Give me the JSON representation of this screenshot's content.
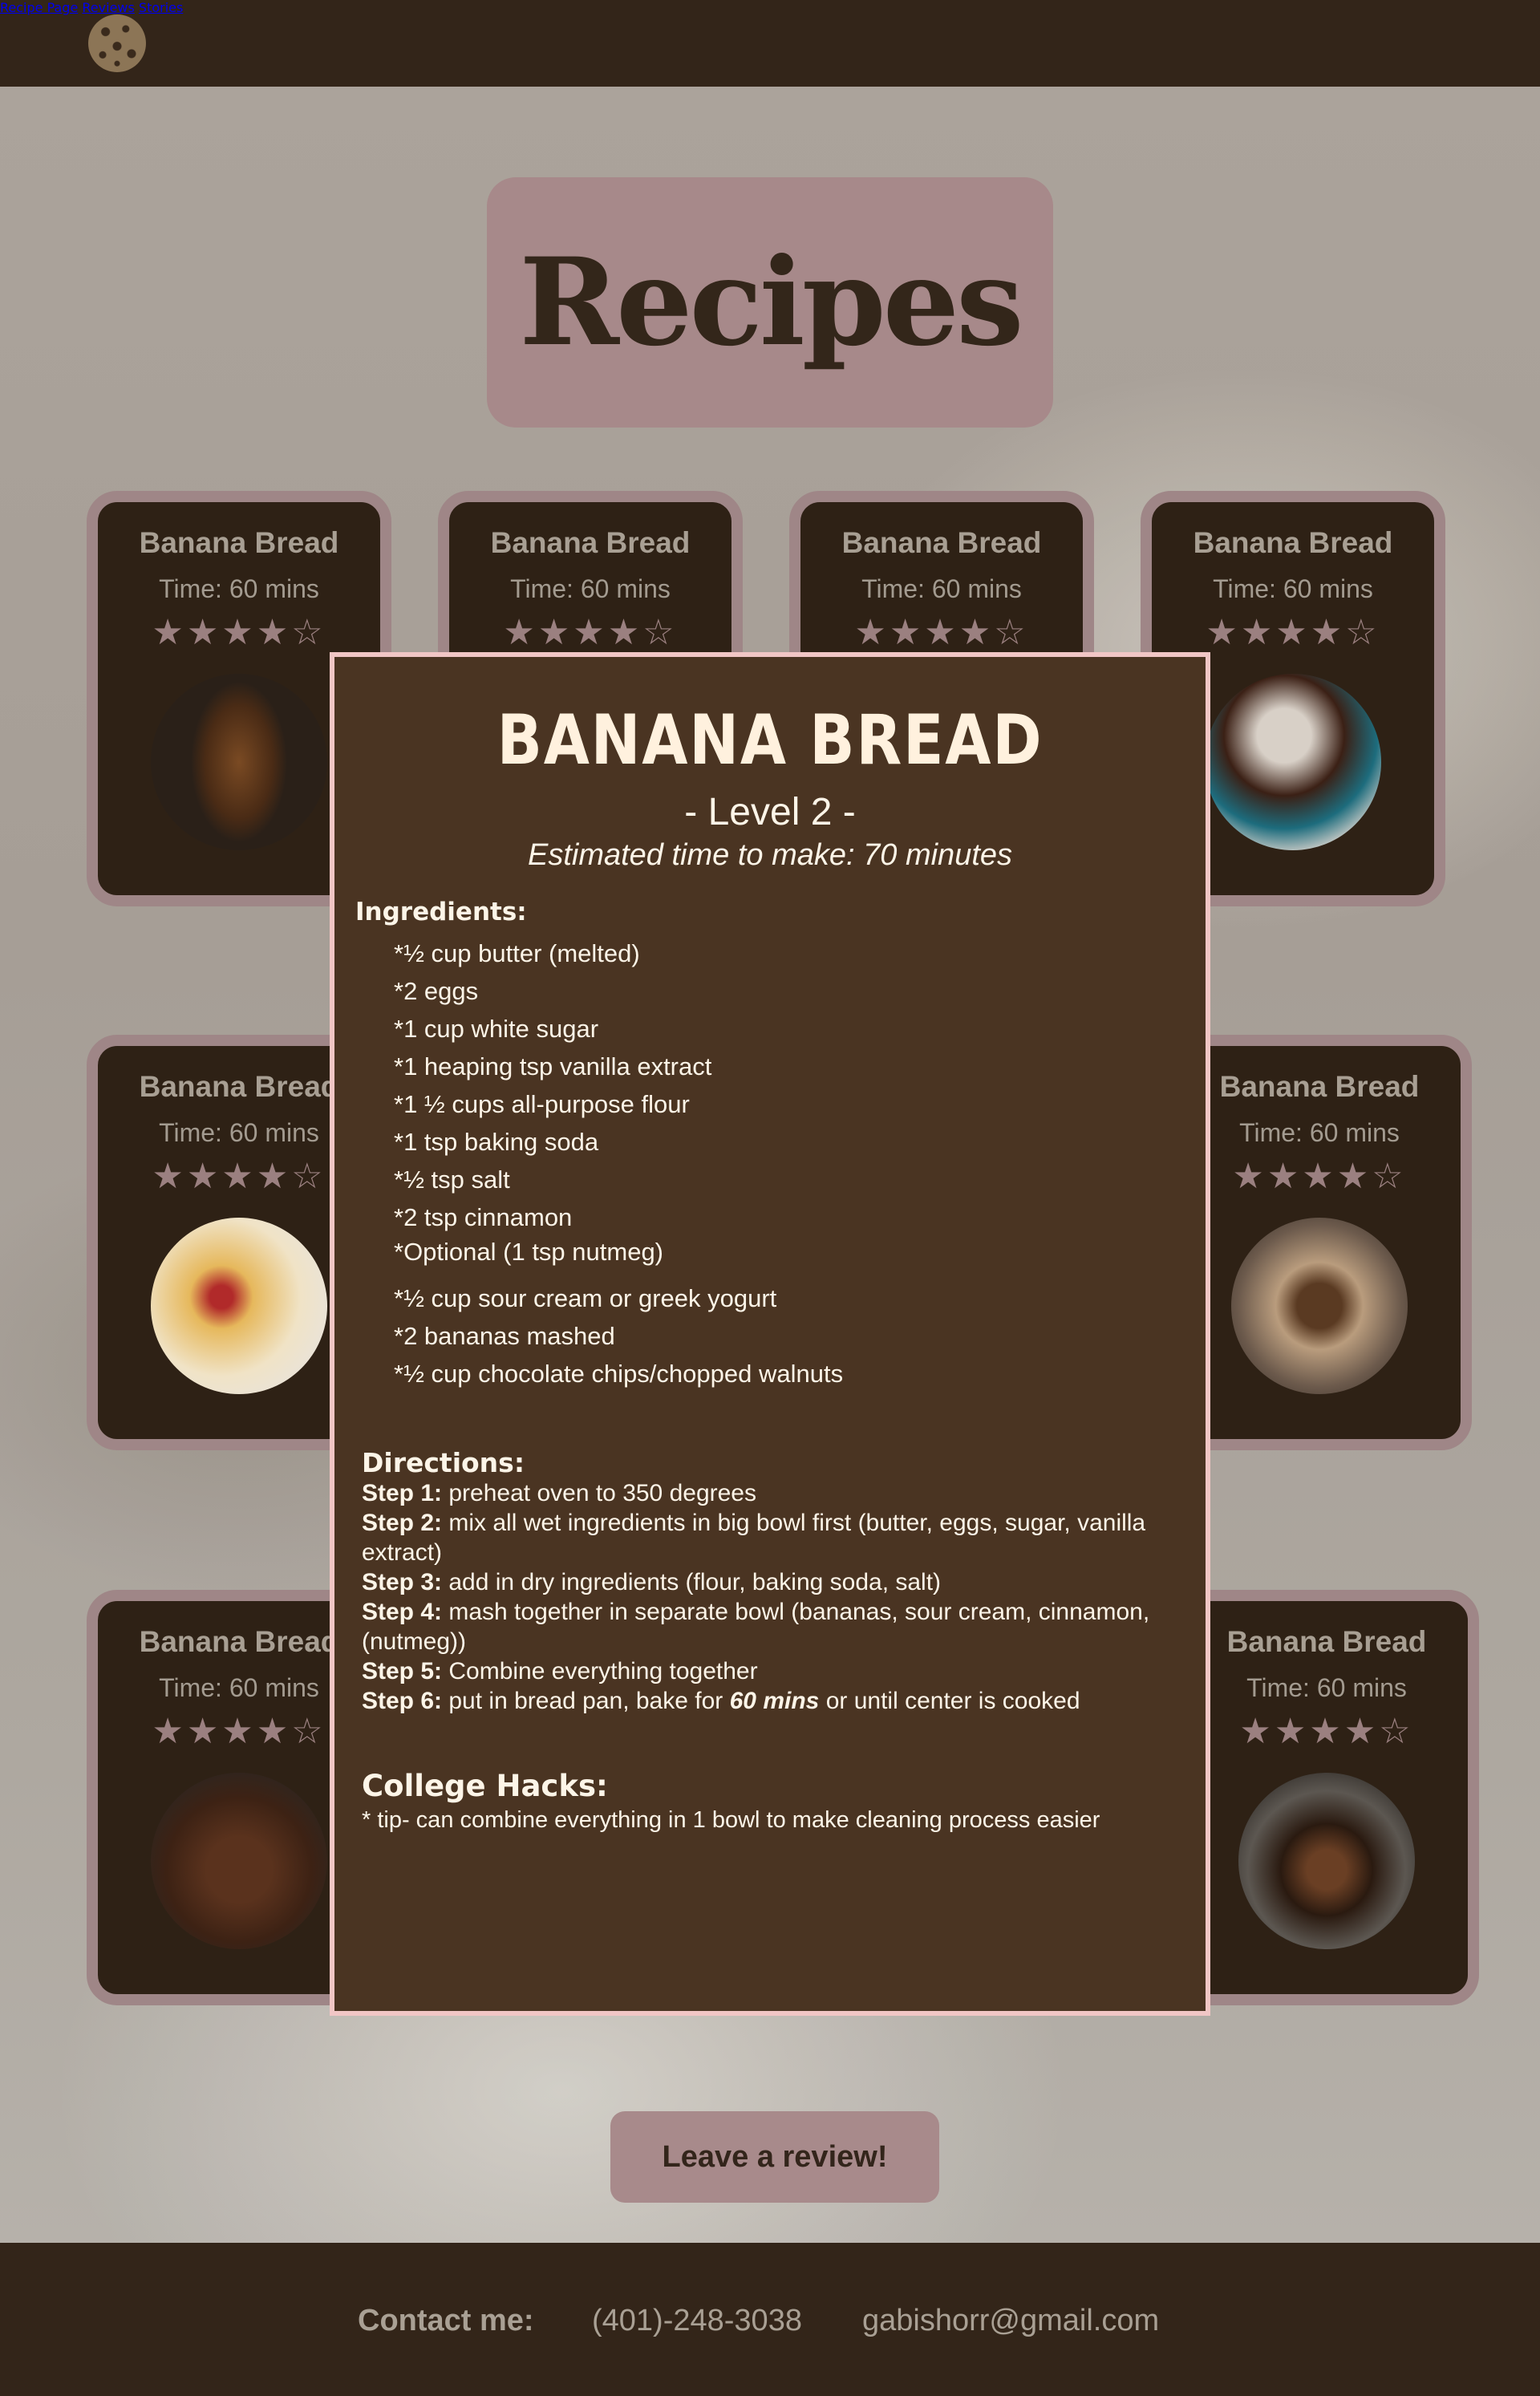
{
  "header": {
    "logo_icon": "cookie-icon",
    "nav": [
      {
        "label": "Recipe Page"
      },
      {
        "label": "Reviews"
      },
      {
        "label": "Stories"
      }
    ]
  },
  "page_title": "Recipes",
  "cards": [
    {
      "title": "Banana Bread",
      "time": "Time: 60 mins",
      "stars": "★★★★☆",
      "rating": 4,
      "image_icon": "banana-bread-photo"
    },
    {
      "title": "Banana Bread",
      "time": "Time: 60 mins",
      "stars": "★★★★☆",
      "rating": 4,
      "image_icon": "recipe-photo"
    },
    {
      "title": "Banana Bread",
      "time": "Time: 60 mins",
      "stars": "★★★★☆",
      "rating": 4,
      "image_icon": "recipe-photo"
    },
    {
      "title": "Banana Bread",
      "time": "Time: 60 mins",
      "stars": "★★★★☆",
      "rating": 4,
      "image_icon": "mug-cake-photo"
    },
    {
      "title": "Banana Bread",
      "time": "Time: 60 mins",
      "stars": "★★★★☆",
      "rating": 4,
      "image_icon": "crepes-photo"
    },
    {
      "title": "Banana Bread",
      "time": "Time: 60 mins",
      "stars": "★★★★☆",
      "rating": 4,
      "image_icon": "loaf-photo"
    },
    {
      "title": "Banana Bread",
      "time": "Time: 60 mins",
      "stars": "★★★★☆",
      "rating": 4,
      "image_icon": "brownie-photo"
    },
    {
      "title": "Banana Bread",
      "time": "Time: 60 mins",
      "stars": "★★★★☆",
      "rating": 4,
      "image_icon": "iced-drink-photo"
    }
  ],
  "modal": {
    "title": "BANANA BREAD",
    "level": "- Level 2 -",
    "estimated_time": "Estimated time to make: 70 minutes",
    "ingredients_heading": "Ingredients:",
    "ingredients": [
      "*½ cup butter (melted)",
      "*2 eggs",
      "*1 cup white sugar",
      "*1 heaping tsp vanilla extract",
      "*1 ½ cups all-purpose flour",
      "*1 tsp baking soda",
      "*½ tsp salt",
      "*2 tsp cinnamon",
      "*Optional (1 tsp nutmeg)",
      "*½ cup sour cream or greek yogurt",
      "*2 bananas mashed",
      "*½ cup chocolate chips/chopped walnuts"
    ],
    "directions_heading": "Directions:",
    "steps": [
      {
        "label": "Step 1:",
        "text": " preheat oven to 350 degrees"
      },
      {
        "label": "Step 2:",
        "text": " mix all wet ingredients in big bowl first (butter, eggs, sugar, vanilla extract)"
      },
      {
        "label": "Step 3:",
        "text": " add in dry ingredients (flour, baking soda, salt)"
      },
      {
        "label": "Step 4:",
        "text": " mash together in separate bowl (bananas, sour cream, cinnamon, (nutmeg))"
      },
      {
        "label": "Step 5:",
        "text": " Combine everything together"
      },
      {
        "label": "Step 6:",
        "text": " put in bread pan, bake for ",
        "emphasis": "60 mins",
        "text_after": " or until center is cooked"
      }
    ],
    "hacks_heading": "College Hacks:",
    "hack": "* tip-  can combine everything in 1 bowl to make cleaning process easier"
  },
  "review_button": "Leave a review!",
  "footer": {
    "contact_label": "Contact me:",
    "phone": "(401)-248-3038",
    "email": "gabishorr@gmail.com"
  },
  "colors": {
    "header_bg": "#332519",
    "accent_pink": "#a7898a",
    "modal_bg": "#4a3422",
    "modal_border": "#f1c6c5"
  }
}
